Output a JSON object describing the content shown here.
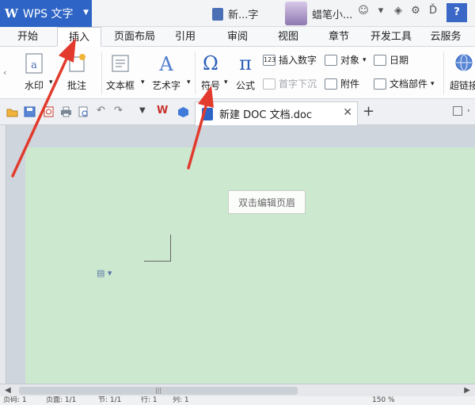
{
  "app": {
    "name": "WPS 文字",
    "doc_short": "新...字",
    "user": "蜡笔小...",
    "help": "?"
  },
  "menu": {
    "tabs": [
      "开始",
      "插入",
      "页面布局",
      "引用",
      "审阅",
      "视图",
      "章节",
      "开发工具",
      "云服务"
    ],
    "active": "插入"
  },
  "ribbon": {
    "watermark": "水印",
    "comment": "批注",
    "textbox": "文本框",
    "wordart": "艺术字",
    "symbol": "符号",
    "formula": "公式",
    "insert_number": "插入数字",
    "object": "对象",
    "date": "日期",
    "dropcap": "首字下沉",
    "attachment": "附件",
    "doc_parts": "文档部件",
    "hyperlink": "超链接",
    "number_icon_text": "123",
    "omega": "Ω",
    "pi": "π"
  },
  "document": {
    "tab_title": "新建 DOC 文档.doc",
    "header_hint": "双击编辑页眉"
  },
  "statusbar": {
    "page_label": "页码: 1",
    "pages": "页面: 1/1",
    "section": "节: 1/1",
    "row": "行: 1",
    "col": "列: 1",
    "zoom": "150 %"
  },
  "colors": {
    "accent": "#2e64c5",
    "page_bg": "#cce8cf",
    "arrow": "#e23b2e"
  }
}
